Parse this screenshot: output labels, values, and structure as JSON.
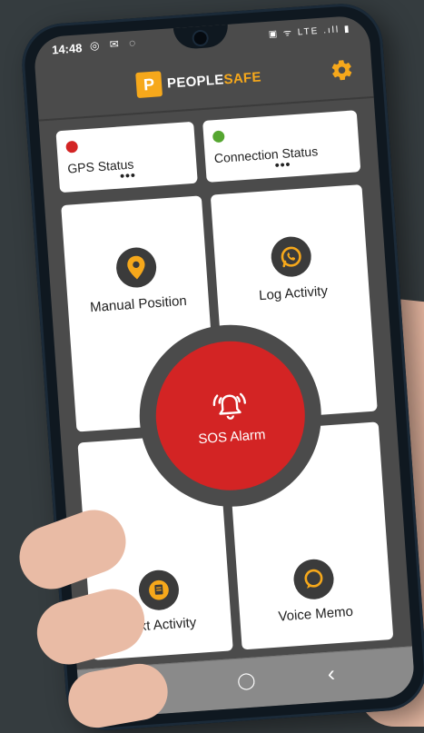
{
  "status_bar": {
    "time": "14:48",
    "left_icons": "◎ ✉ ◌",
    "right_icons": "▣ ᯤ LTE .ıll ▮"
  },
  "header": {
    "logo_letter": "P",
    "brand_part1": "PEOPLE",
    "brand_part2": "SAFE",
    "settings_icon": "gear-icon"
  },
  "status_cards": [
    {
      "label": "GPS Status",
      "more": "•••",
      "dot_color": "#d32424"
    },
    {
      "label": "Connection Status",
      "more": "•••",
      "dot_color": "#55a630"
    }
  ],
  "tiles": {
    "manual_position": {
      "label": "Manual Position",
      "icon": "map-pin-icon"
    },
    "log_activity": {
      "label": "Log Activity",
      "icon": "whatsapp-icon"
    },
    "text_activity": {
      "label": "Text Activity",
      "icon": "document-chat-icon"
    },
    "voice_memo": {
      "label": "Voice Memo",
      "icon": "speech-bubble-icon"
    }
  },
  "sos": {
    "label": "SOS Alarm",
    "icon": "alarm-bell-icon"
  },
  "navigation": {
    "recents": "|||",
    "home": "◯",
    "back": "‹"
  },
  "colors": {
    "accent": "#f6a81b",
    "sos": "#d32424",
    "screen_bg": "#4b4b4b"
  }
}
